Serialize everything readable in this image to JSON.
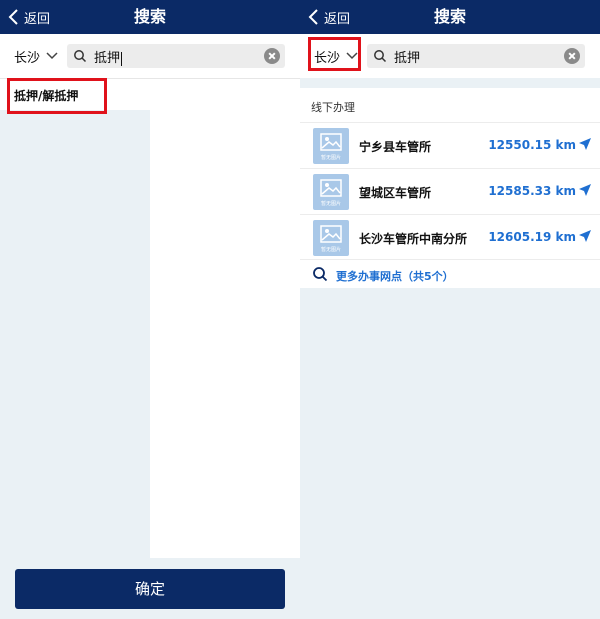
{
  "left": {
    "back_label": "返回",
    "title": "搜索",
    "city": "长沙",
    "search_value": "抵押",
    "suggestions": [
      "抵押/解抵押"
    ],
    "confirm_label": "确定"
  },
  "right": {
    "back_label": "返回",
    "title": "搜索",
    "city": "长沙",
    "search_value": "抵押",
    "section_title": "线下办理",
    "results": [
      {
        "name": "宁乡县车管所",
        "distance": "12550.15 km",
        "thumb_label": "暂无图片"
      },
      {
        "name": "望城区车管所",
        "distance": "12585.33 km",
        "thumb_label": "暂无图片"
      },
      {
        "name": "长沙车管所中南分所",
        "distance": "12605.19 km",
        "thumb_label": "暂无图片"
      }
    ],
    "more_label": "更多办事网点（共5个）"
  },
  "colors": {
    "navbar": "#0b2a66",
    "accent_blue": "#1f6fd1",
    "highlight_red": "#e0121b",
    "background": "#eaf1f5",
    "thumb": "#a9c8e8"
  },
  "icons": {
    "back": "chevron-left-icon",
    "dropdown": "chevron-down-icon",
    "search": "search-icon",
    "clear": "clear-icon",
    "thumb": "image-placeholder-icon",
    "navigate": "navigate-arrow-icon"
  }
}
